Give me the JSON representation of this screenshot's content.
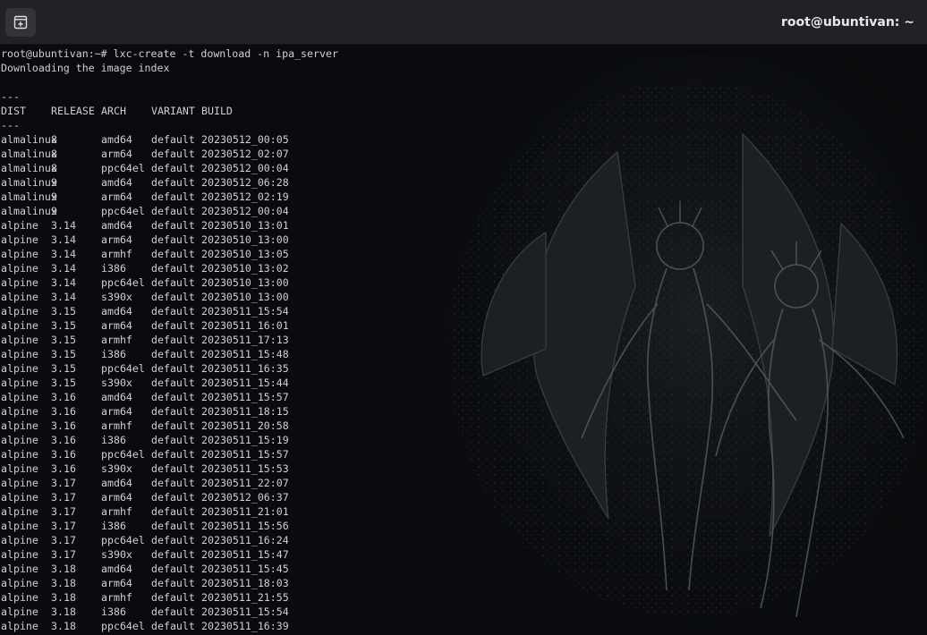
{
  "window": {
    "title": "root@ubuntivan: ~",
    "new_tab_icon": "new-tab-plus-icon"
  },
  "terminal": {
    "command_line": "root@ubuntivan:~# lxc-create -t download -n ipa_server",
    "status_line": "Downloading the image index",
    "blank_line": "",
    "separator": "---",
    "headers": [
      "DIST",
      "RELEASE",
      "ARCH",
      "VARIANT",
      "BUILD"
    ],
    "rows": [
      [
        "almalinux",
        "8",
        "amd64",
        "default",
        "20230512_00:05"
      ],
      [
        "almalinux",
        "8",
        "arm64",
        "default",
        "20230512_02:07"
      ],
      [
        "almalinux",
        "8",
        "ppc64el",
        "default",
        "20230512_00:04"
      ],
      [
        "almalinux",
        "9",
        "amd64",
        "default",
        "20230512_06:28"
      ],
      [
        "almalinux",
        "9",
        "arm64",
        "default",
        "20230512_02:19"
      ],
      [
        "almalinux",
        "9",
        "ppc64el",
        "default",
        "20230512_00:04"
      ],
      [
        "alpine",
        "3.14",
        "amd64",
        "default",
        "20230510_13:01"
      ],
      [
        "alpine",
        "3.14",
        "arm64",
        "default",
        "20230510_13:00"
      ],
      [
        "alpine",
        "3.14",
        "armhf",
        "default",
        "20230510_13:05"
      ],
      [
        "alpine",
        "3.14",
        "i386",
        "default",
        "20230510_13:02"
      ],
      [
        "alpine",
        "3.14",
        "ppc64el",
        "default",
        "20230510_13:00"
      ],
      [
        "alpine",
        "3.14",
        "s390x",
        "default",
        "20230510_13:00"
      ],
      [
        "alpine",
        "3.15",
        "amd64",
        "default",
        "20230511_15:54"
      ],
      [
        "alpine",
        "3.15",
        "arm64",
        "default",
        "20230511_16:01"
      ],
      [
        "alpine",
        "3.15",
        "armhf",
        "default",
        "20230511_17:13"
      ],
      [
        "alpine",
        "3.15",
        "i386",
        "default",
        "20230511_15:48"
      ],
      [
        "alpine",
        "3.15",
        "ppc64el",
        "default",
        "20230511_16:35"
      ],
      [
        "alpine",
        "3.15",
        "s390x",
        "default",
        "20230511_15:44"
      ],
      [
        "alpine",
        "3.16",
        "amd64",
        "default",
        "20230511_15:57"
      ],
      [
        "alpine",
        "3.16",
        "arm64",
        "default",
        "20230511_18:15"
      ],
      [
        "alpine",
        "3.16",
        "armhf",
        "default",
        "20230511_20:58"
      ],
      [
        "alpine",
        "3.16",
        "i386",
        "default",
        "20230511_15:19"
      ],
      [
        "alpine",
        "3.16",
        "ppc64el",
        "default",
        "20230511_15:57"
      ],
      [
        "alpine",
        "3.16",
        "s390x",
        "default",
        "20230511_15:53"
      ],
      [
        "alpine",
        "3.17",
        "amd64",
        "default",
        "20230511_22:07"
      ],
      [
        "alpine",
        "3.17",
        "arm64",
        "default",
        "20230512_06:37"
      ],
      [
        "alpine",
        "3.17",
        "armhf",
        "default",
        "20230511_21:01"
      ],
      [
        "alpine",
        "3.17",
        "i386",
        "default",
        "20230511_15:56"
      ],
      [
        "alpine",
        "3.17",
        "ppc64el",
        "default",
        "20230511_16:24"
      ],
      [
        "alpine",
        "3.17",
        "s390x",
        "default",
        "20230511_15:47"
      ],
      [
        "alpine",
        "3.18",
        "amd64",
        "default",
        "20230511_15:45"
      ],
      [
        "alpine",
        "3.18",
        "arm64",
        "default",
        "20230511_18:03"
      ],
      [
        "alpine",
        "3.18",
        "armhf",
        "default",
        "20230511_21:55"
      ],
      [
        "alpine",
        "3.18",
        "i386",
        "default",
        "20230511_15:54"
      ],
      [
        "alpine",
        "3.18",
        "ppc64el",
        "default",
        "20230511_16:39"
      ]
    ]
  },
  "colors": {
    "titlebar": "#222226",
    "terminal_bg": "#090b0e",
    "text": "#d0d0d0"
  }
}
